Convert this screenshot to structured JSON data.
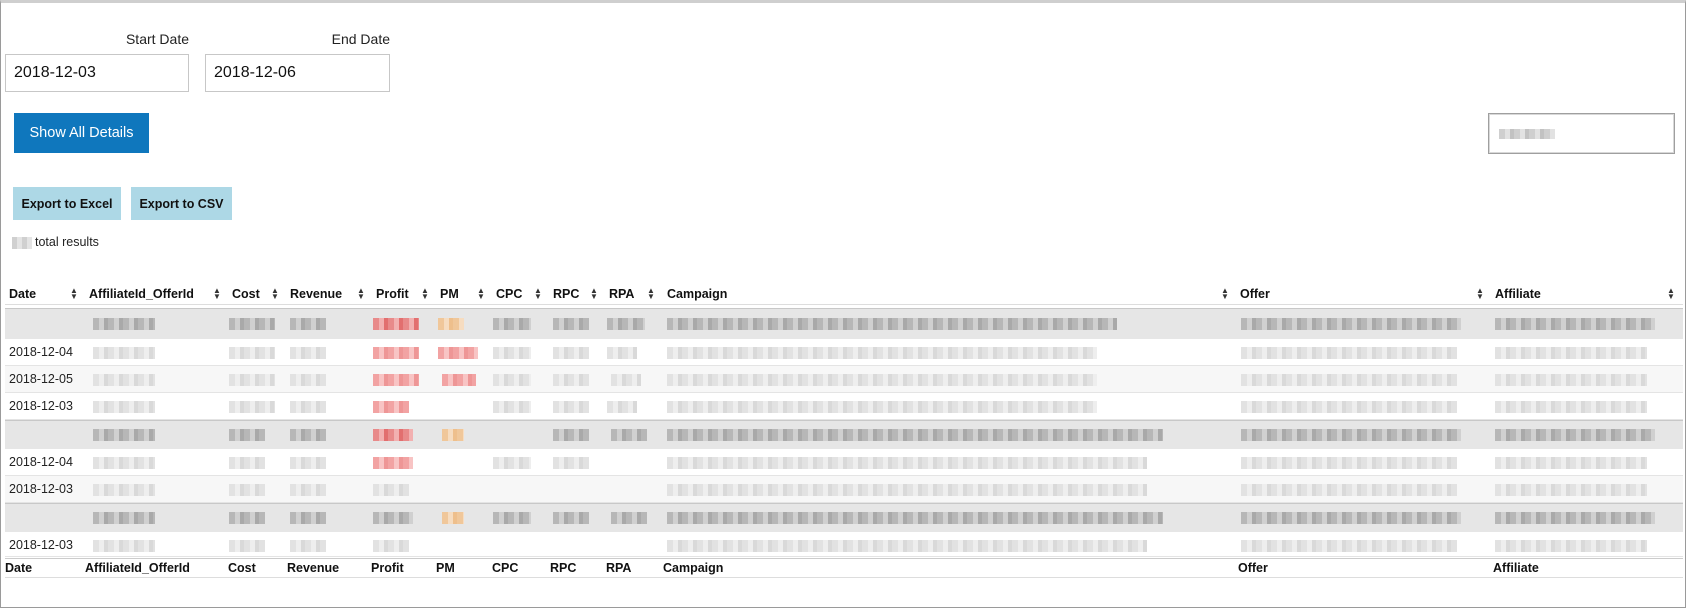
{
  "filters": {
    "start_date_label": "Start Date",
    "start_date_value": "2018-12-03",
    "end_date_label": "End Date",
    "end_date_value": "2018-12-06"
  },
  "actions": {
    "show_all_details": "Show All Details",
    "export_excel": "Export to Excel",
    "export_csv": "Export to CSV"
  },
  "summary": {
    "total_results_label": "total results"
  },
  "table": {
    "columns": [
      "Date",
      "AffiliateId_OfferId",
      "Cost",
      "Revenue",
      "Profit",
      "PM",
      "CPC",
      "RPC",
      "RPA",
      "Campaign",
      "Offer",
      "Affiliate"
    ],
    "rows": [
      {
        "date": "",
        "kind": "group"
      },
      {
        "date": "2018-12-04",
        "kind": "plain"
      },
      {
        "date": "2018-12-05",
        "kind": "alt"
      },
      {
        "date": "2018-12-03",
        "kind": "plain"
      },
      {
        "date": "",
        "kind": "group"
      },
      {
        "date": "2018-12-04",
        "kind": "plain"
      },
      {
        "date": "2018-12-03",
        "kind": "alt"
      },
      {
        "date": "",
        "kind": "group"
      },
      {
        "date": "2018-12-03",
        "kind": "plain"
      }
    ]
  },
  "colors": {
    "primary_button": "#0f77bd",
    "export_button": "#add8e6",
    "group_row": "#e6e6e6"
  }
}
